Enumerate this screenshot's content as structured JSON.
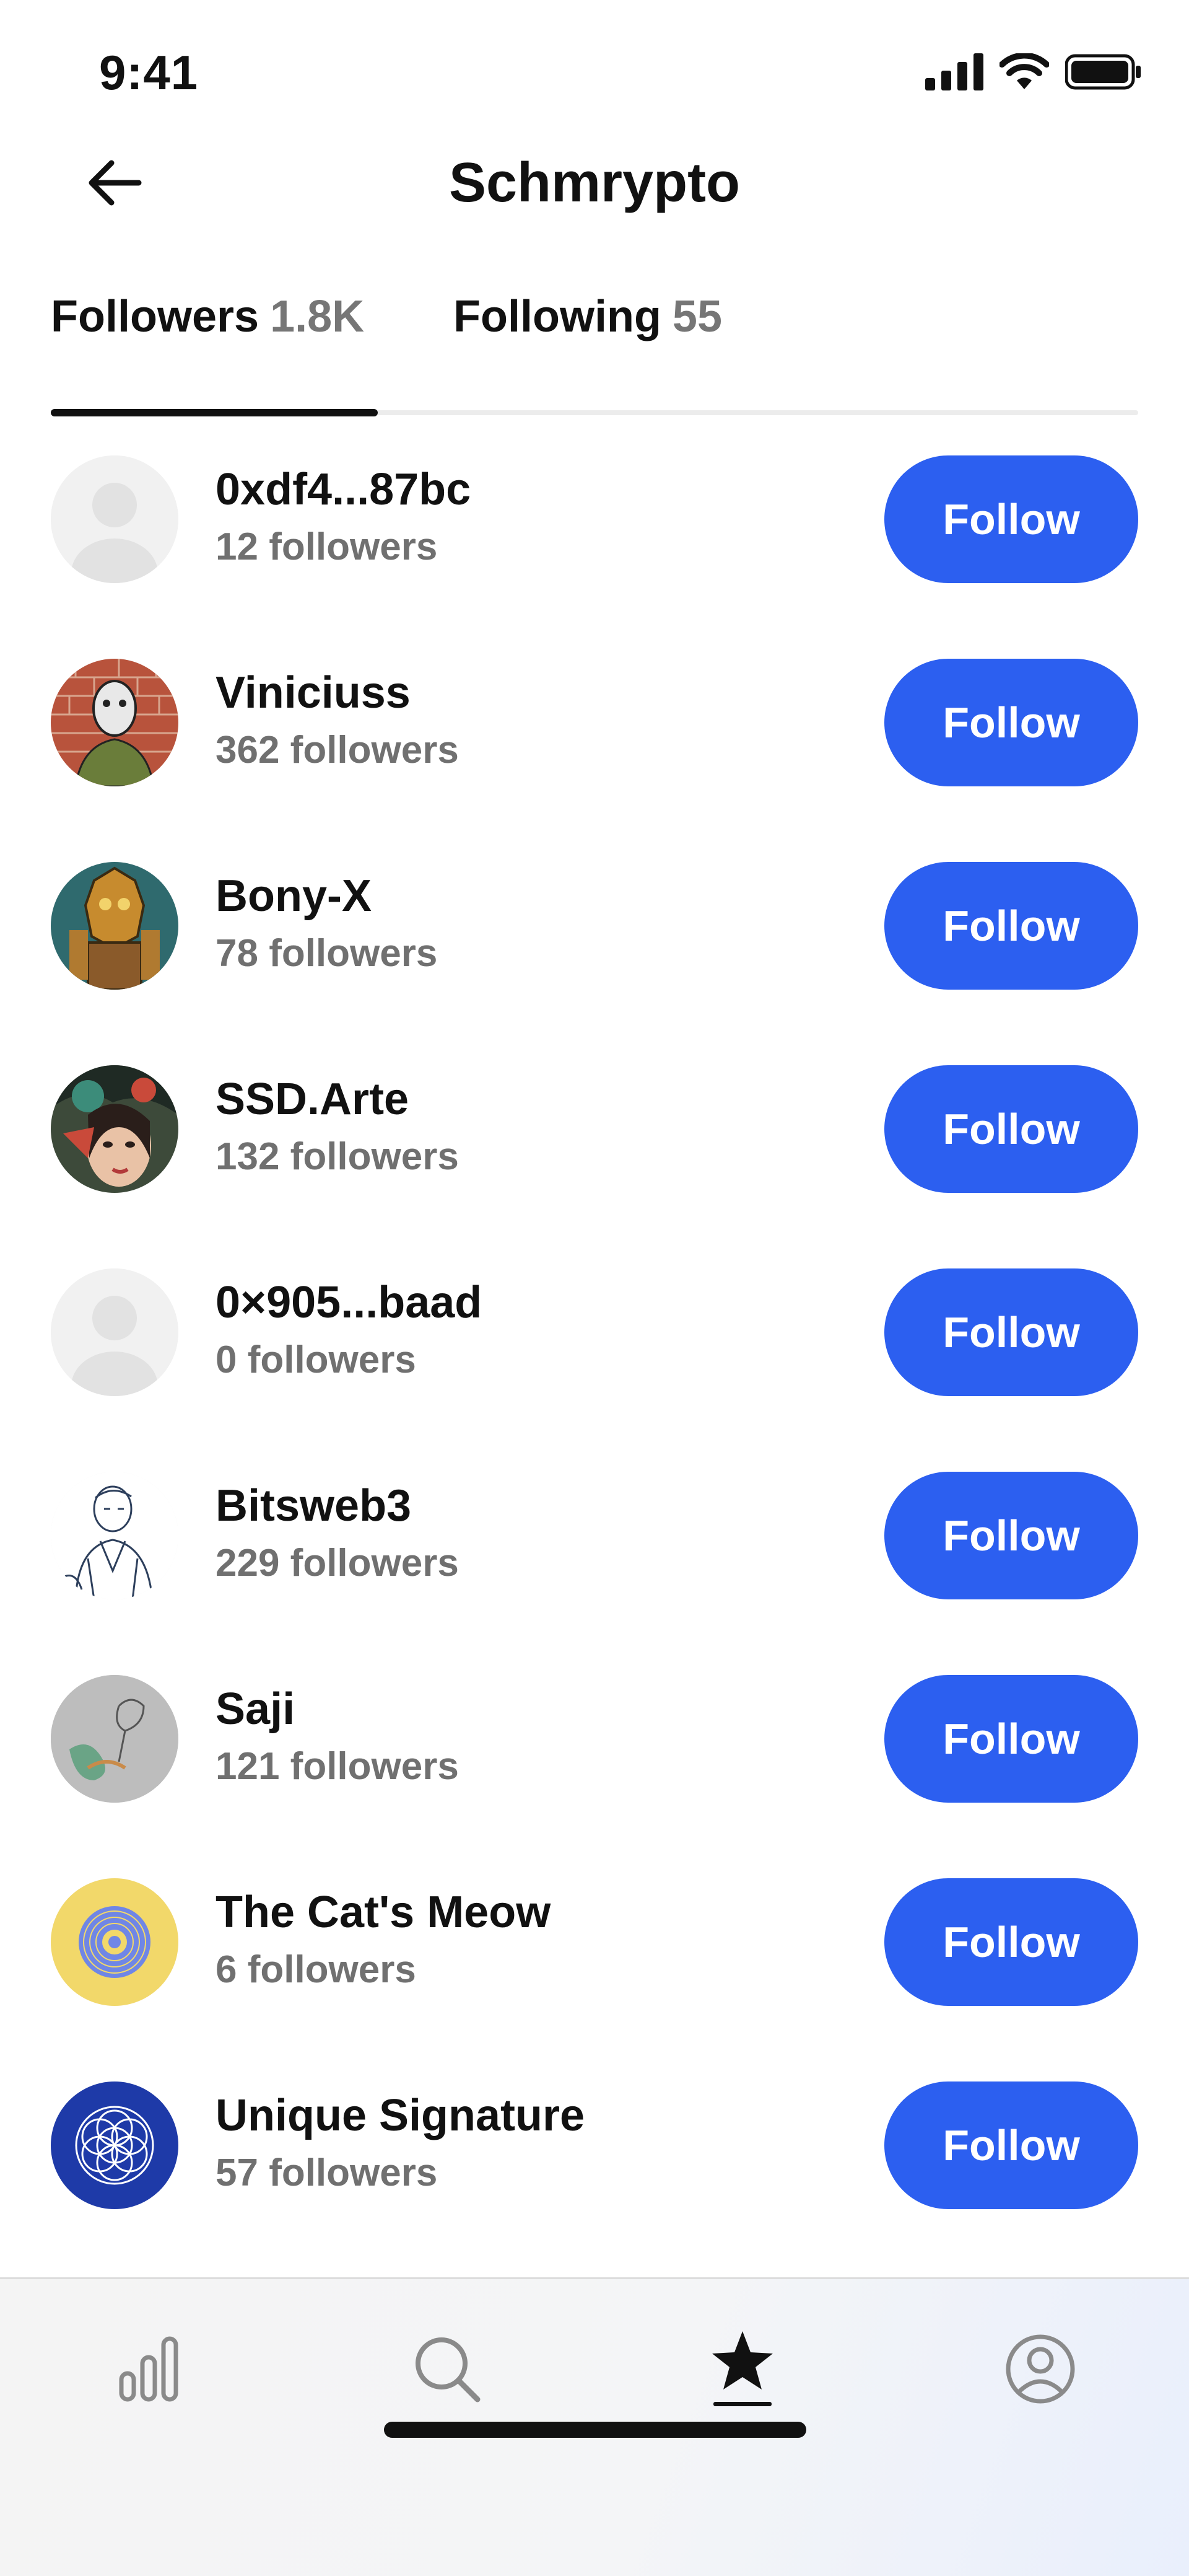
{
  "status_bar": {
    "time": "9:41",
    "icons": [
      "cellular-signal-icon",
      "wifi-icon",
      "battery-icon"
    ]
  },
  "header": {
    "title": "Schmrypto",
    "back_icon": "arrow-left-icon"
  },
  "tabs": [
    {
      "label": "Followers",
      "count": "1.8K",
      "active": true
    },
    {
      "label": "Following",
      "count": "55",
      "active": false
    }
  ],
  "followers": [
    {
      "name": "0xdf4...87bc",
      "subtext": "12 followers",
      "button": "Follow",
      "avatar": "placeholder-avatar"
    },
    {
      "name": "Viniciuss",
      "subtext": "362 followers",
      "button": "Follow",
      "avatar": "brick-wall-character-avatar"
    },
    {
      "name": "Bony-X",
      "subtext": "78 followers",
      "button": "Follow",
      "avatar": "robot-art-avatar"
    },
    {
      "name": "SSD.Arte",
      "subtext": "132 followers",
      "button": "Follow",
      "avatar": "painted-face-avatar"
    },
    {
      "name": "0×905...baad",
      "subtext": "0 followers",
      "button": "Follow",
      "avatar": "placeholder-avatar"
    },
    {
      "name": "Bitsweb3",
      "subtext": "229 followers",
      "button": "Follow",
      "avatar": "sketch-portrait-avatar"
    },
    {
      "name": "Saji",
      "subtext": "121 followers",
      "button": "Follow",
      "avatar": "sketch-art-avatar"
    },
    {
      "name": "The Cat's Meow",
      "subtext": "6 followers",
      "button": "Follow",
      "avatar": "yellow-mandala-avatar"
    },
    {
      "name": "Unique Signature",
      "subtext": "57 followers",
      "button": "Follow",
      "avatar": "blue-flower-of-life-avatar"
    }
  ],
  "tab_bar": {
    "items": [
      "stats-icon",
      "search-icon",
      "star-icon",
      "profile-icon"
    ],
    "active": "star-icon"
  },
  "colors": {
    "accent": "#2c5ff0",
    "muted_text": "#707070",
    "text": "#111111"
  }
}
